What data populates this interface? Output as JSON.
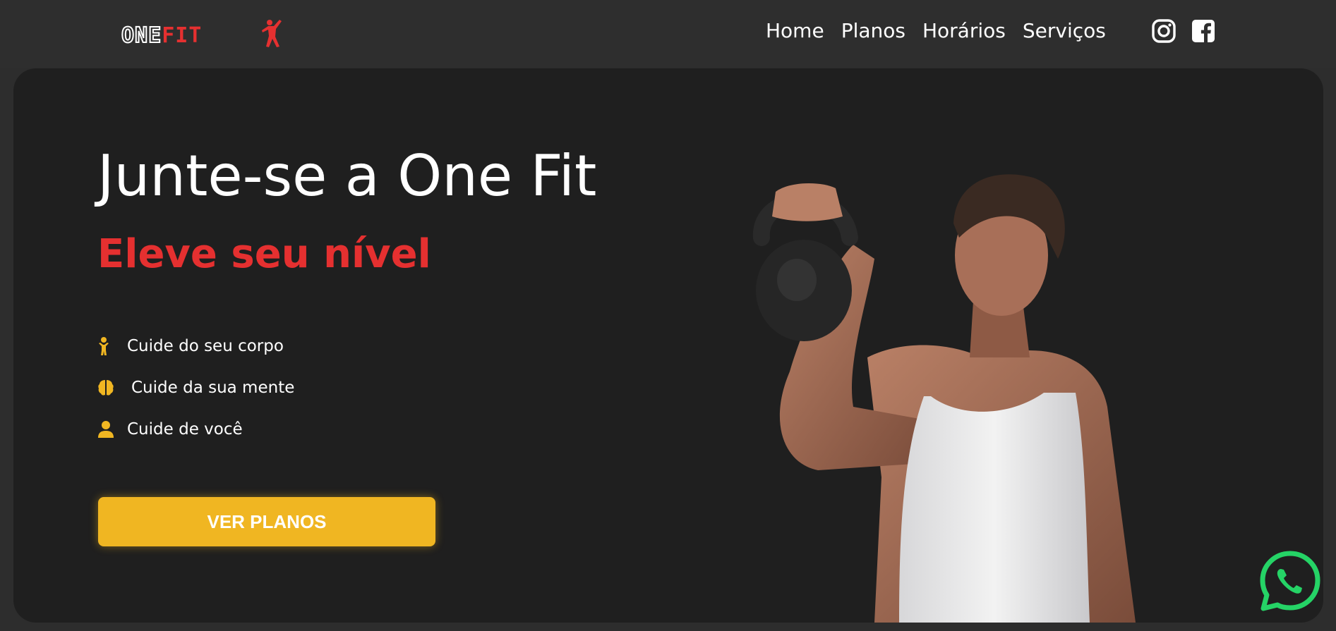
{
  "brand": {
    "logo_one": "ONE",
    "logo_fit": "FIT",
    "icon": "runner-figure-icon"
  },
  "nav": {
    "links": [
      "Home",
      "Planos",
      "Horários",
      "Serviços"
    ],
    "social": [
      "instagram-icon",
      "facebook-icon"
    ]
  },
  "hero": {
    "title": "Junte-se a One Fit",
    "subtitle": "Eleve seu nível",
    "benefits": [
      {
        "icon": "child-figure-icon",
        "label": "Cuide do seu corpo"
      },
      {
        "icon": "brain-icon",
        "label": "Cuide da sua mente"
      },
      {
        "icon": "user-icon",
        "label": "Cuide de você"
      }
    ],
    "cta": "VER PLANOS",
    "photo": "man-with-kettlebell-photo"
  },
  "floating": {
    "whatsapp": "whatsapp-icon"
  },
  "colors": {
    "accent_red": "#e53030",
    "accent_yellow": "#f0b622",
    "background": "#1f1f1f",
    "navbar": "#2e2e2e",
    "whatsapp_green": "#25d366"
  }
}
